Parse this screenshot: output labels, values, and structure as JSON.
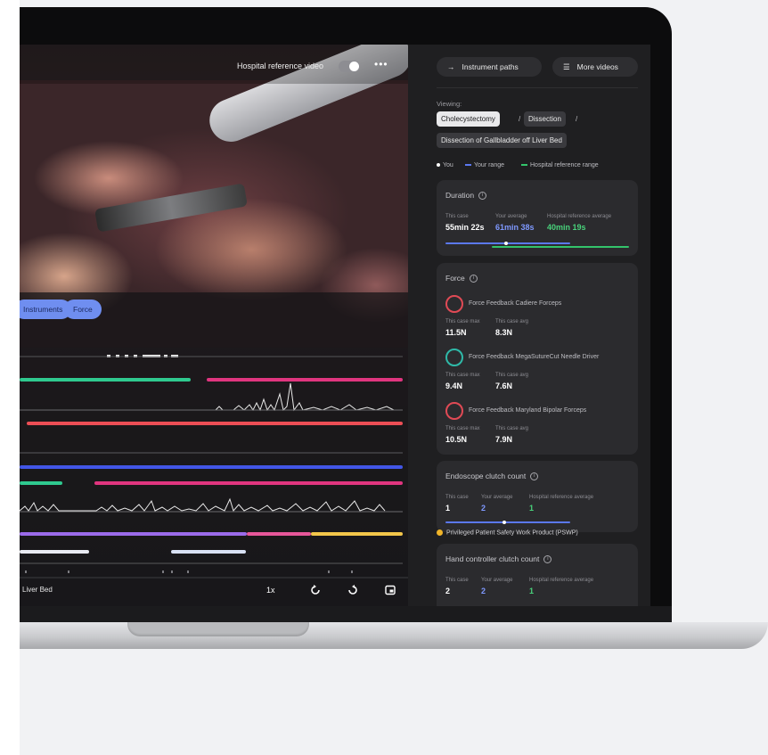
{
  "video": {
    "reference_toggle_label": "Hospital reference video",
    "chips": {
      "instruments": "Instruments",
      "force": "Force"
    },
    "timeline_label": "Liver Bed",
    "speed": "1x"
  },
  "panel": {
    "buttons": {
      "instrument_paths": "Instrument paths",
      "more_videos": "More videos"
    },
    "viewing_label": "Viewing:",
    "breadcrumb": [
      "Cholecystectomy",
      "Dissection",
      "Dissection of Gallbladder off Liver Bed"
    ],
    "separator": "/",
    "legend": {
      "you": "You",
      "your_range": "Your range",
      "hospital_range": "Hospital reference range"
    },
    "duration": {
      "title": "Duration",
      "labels": [
        "This case",
        "Your average",
        "Hospital reference average"
      ],
      "values": [
        "55min 22s",
        "61min 38s",
        "40min 19s"
      ]
    },
    "force": {
      "title": "Force",
      "labels": [
        "This case max",
        "This case avg"
      ],
      "items": [
        {
          "name": "Force Feedback Cadiere Forceps",
          "max": "11.5N",
          "avg": "8.3N"
        },
        {
          "name": "Force Feedback MegaSutureCut Needle Driver",
          "max": "9.4N",
          "avg": "7.6N"
        },
        {
          "name": "Force Feedback Maryland Bipolar Forceps",
          "max": "10.5N",
          "avg": "7.9N"
        }
      ]
    },
    "endoscope": {
      "title": "Endoscope clutch count",
      "labels": [
        "This case",
        "Your average",
        "Hospital reference average"
      ],
      "values": [
        "1",
        "2",
        "1"
      ]
    },
    "notice": "Privileged Patient Safety Work Product (PSWP)",
    "hand_controller": {
      "title": "Hand controller clutch count",
      "labels": [
        "This case",
        "Your average",
        "Hospital reference average"
      ],
      "values": [
        "2",
        "2",
        "1"
      ]
    }
  },
  "colors": {
    "you": "#ffffff",
    "your_range": "#5b78f0",
    "hospital_range": "#33c46b",
    "track_green": "#2fc98f",
    "track_magenta": "#e0357f",
    "track_red": "#ec4e55",
    "track_blue": "#4256e6",
    "track_purple": "#9b6bea",
    "track_yellow": "#f3c64a"
  }
}
